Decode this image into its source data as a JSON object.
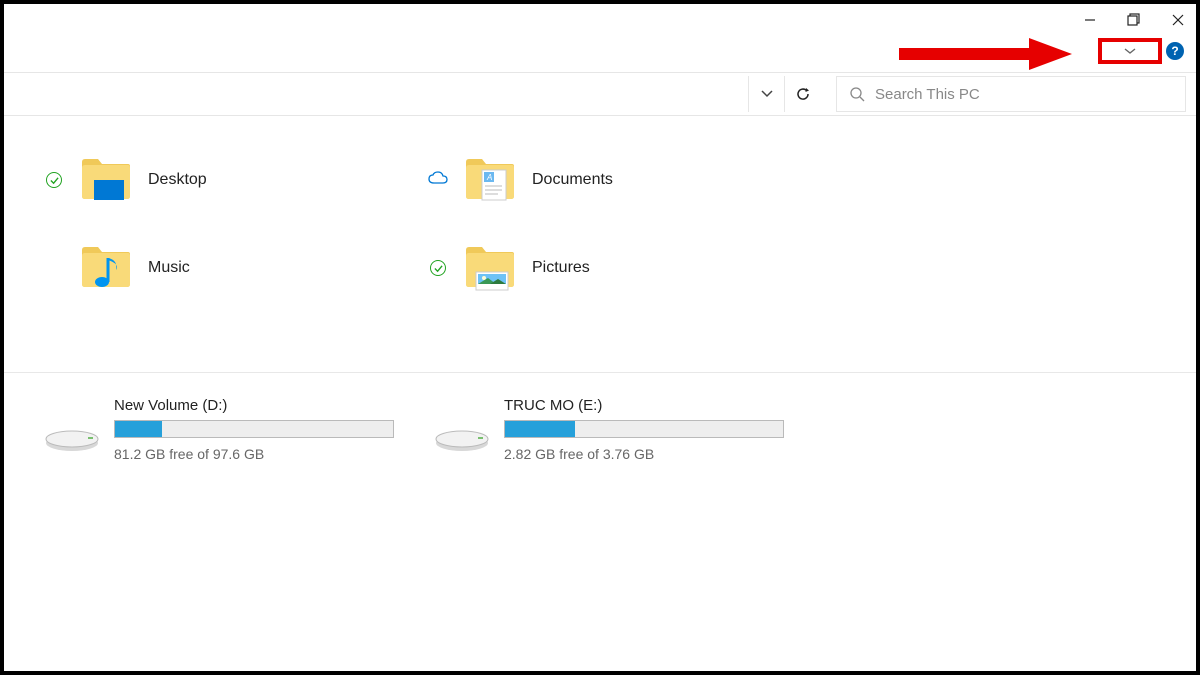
{
  "window": {
    "search_placeholder": "Search This PC"
  },
  "folders": [
    {
      "name": "Desktop",
      "sync": "check",
      "iconType": "desktop"
    },
    {
      "name": "Documents",
      "sync": "cloud",
      "iconType": "documents"
    },
    {
      "name": "Music",
      "sync": "none",
      "iconType": "music"
    },
    {
      "name": "Pictures",
      "sync": "check",
      "iconType": "pictures"
    }
  ],
  "drives": [
    {
      "name": "New Volume (D:)",
      "status": "81.2 GB free of 97.6 GB",
      "fillPercent": 17
    },
    {
      "name": "TRUC MO (E:)",
      "status": "2.82 GB free of 3.76 GB",
      "fillPercent": 25
    }
  ],
  "help_label": "?"
}
